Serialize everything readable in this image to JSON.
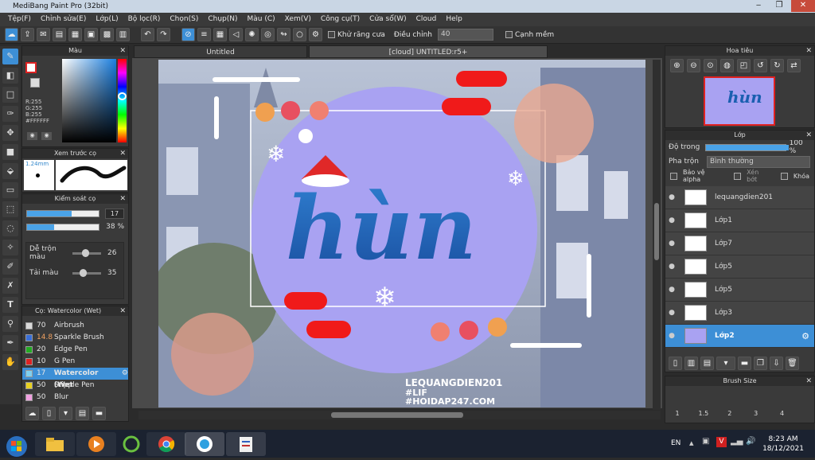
{
  "window": {
    "title": "MediBang Paint Pro (32bit)",
    "min": "‒",
    "max": "❐",
    "close": "✕"
  },
  "menu": [
    "Tệp(F)",
    "Chỉnh sửa(E)",
    "Lớp(L)",
    "Bộ lọc(R)",
    "Chọn(S)",
    "Chụp(N)",
    "Màu (C)",
    "Xem(V)",
    "Công cụ(T)",
    "Cửa sổ(W)",
    "Cloud",
    "Help"
  ],
  "toolbar": {
    "antialias_label": "Khử răng cưa",
    "adjust_label": "Điều chỉnh",
    "adjust_value": "40",
    "sharp_edge_label": "Cạnh mềm"
  },
  "tabs": {
    "tab1": "Untitled",
    "tab2": "[cloud] UNTITLED:r5+"
  },
  "color_panel": {
    "title": "Màu",
    "r": "R:255",
    "g": "G:255",
    "b": "B:255",
    "hex": "#FFFFFF"
  },
  "preview_panel": {
    "title": "Xem trước cọ",
    "size": "1.24mm"
  },
  "brush_control": {
    "title": "Kiểm soát cọ",
    "size": "17",
    "opacity": "38 %",
    "mix_label": "Dễ trộn màu",
    "mix_value": "26",
    "reload_label": "Tải màu",
    "reload_value": "35",
    "size_fill": 0.62,
    "opacity_fill": 0.38,
    "mix_pos": 0.45,
    "reload_pos": 0.35
  },
  "brushes": {
    "title": "Cọ: Watercolor (Wet)",
    "items": [
      {
        "size": "70",
        "name": "Airbrush",
        "color": "#d8d8d8"
      },
      {
        "size": "14.8",
        "name": "Sparkle Brush",
        "color": "#3a6fd8"
      },
      {
        "size": "20",
        "name": "Edge Pen",
        "color": "#22aa22"
      },
      {
        "size": "10",
        "name": "G Pen",
        "color": "#dd2222"
      },
      {
        "size": "17",
        "name": "Watercolor (Wet",
        "color": "#7fd0f0"
      },
      {
        "size": "50",
        "name": "Stipple Pen",
        "color": "#e8d020"
      },
      {
        "size": "50",
        "name": "Blur",
        "color": "#f0a0e0"
      }
    ]
  },
  "navigator": {
    "title": "Hoa tiêu"
  },
  "layers": {
    "title": "Lớp",
    "opacity_label": "Độ trong",
    "opacity_value": "100 %",
    "opacity_fill": 1.0,
    "blend_label": "Pha trộn",
    "blend_value": "Bình thường",
    "protect_alpha": "Bảo vệ alpha",
    "clip": "Xén bớt",
    "lock": "Khóa",
    "items": [
      "lequangdien201",
      "Lớp1",
      "Lớp7",
      "Lớp5",
      "Lớp5",
      "Lớp3",
      "Lớp2"
    ]
  },
  "brush_size": {
    "title": "Brush Size",
    "values": [
      "1",
      "1.5",
      "2",
      "3",
      "4"
    ]
  },
  "artwork": {
    "main_text": "hùn",
    "watermark1": "LEQUANGDIEN201",
    "watermark2": "#LIF",
    "watermark3": "#HOIDAP247.COM"
  },
  "taskbar": {
    "lang": "EN",
    "time": "8:23 AM",
    "date": "18/12/2021"
  }
}
